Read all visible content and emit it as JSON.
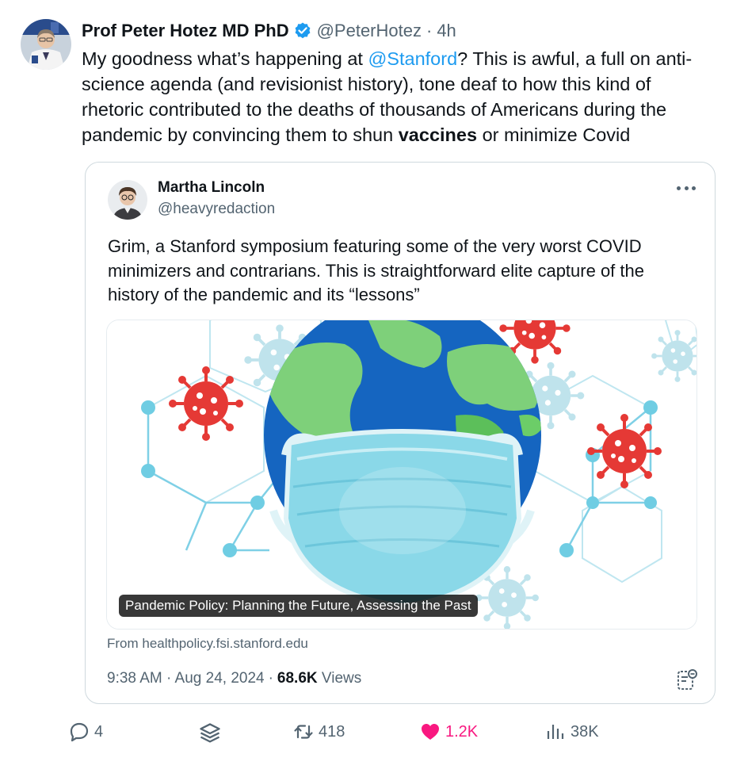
{
  "tweet": {
    "author_name": "Prof Peter Hotez MD PhD",
    "handle": "@PeterHotez",
    "separator": "·",
    "time": "4h",
    "text_before_mention": "My goodness what’s happening at ",
    "mention": "@Stanford",
    "text_after_mention": "? This is awful, a full on anti-science agenda (and revisionist history), tone deaf to how this kind of rhetoric contributed to the deaths of thousands of Americans during the pandemic by convincing them to shun ",
    "text_bold": "vaccines",
    "text_end": " or minimize Covid"
  },
  "quote": {
    "author_name": "Martha Lincoln",
    "handle": "@heavyredaction",
    "text": "Grim, a Stanford symposium featuring some of the very worst COVID minimizers and contrarians. This is straightforward elite capture of the history of the pandemic and its “lessons”",
    "card_caption": "Pandemic Policy: Planning the Future, Assessing the Past",
    "card_source": "From healthpolicy.fsi.stanford.edu",
    "timestamp": "9:38 AM · Aug 24, 2024",
    "dot": "·",
    "views_count": "68.6K",
    "views_label": "Views"
  },
  "actions": {
    "replies": "4",
    "retweets": "418",
    "likes": "1.2K",
    "views": "38K"
  },
  "icons": {
    "verified": "verified-badge-icon",
    "more": "more-horizontal-icon",
    "reply": "reply-bubble-icon",
    "grok": "layers-icon",
    "retweet": "retweet-icon",
    "like": "heart-icon",
    "views": "bar-chart-icon",
    "notes": "community-notes-icon"
  },
  "colors": {
    "link": "#1d9bf0",
    "like": "#f91880",
    "secondary_text": "#536471",
    "verified": "#1d9bf0"
  }
}
